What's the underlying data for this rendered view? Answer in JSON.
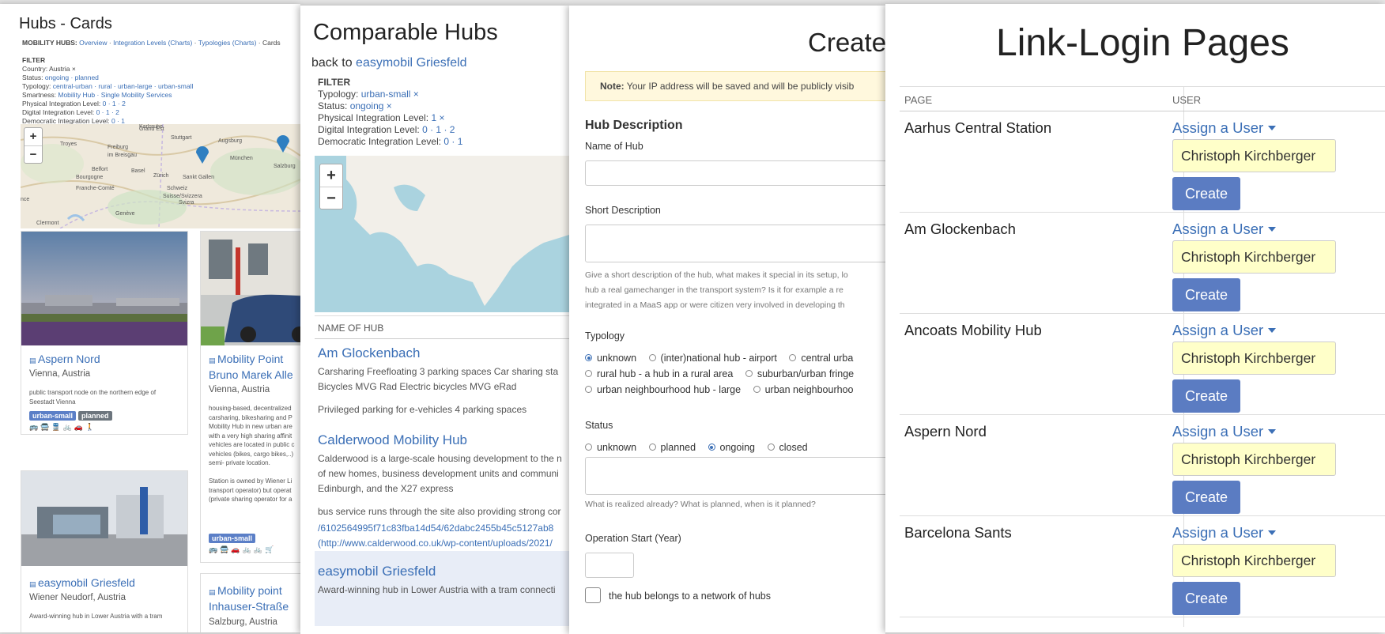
{
  "p1": {
    "title": "Hubs - Cards",
    "nav_prefix": "MOBILITY HUBS:",
    "nav_overview": "Overview",
    "nav_sep1": " · ",
    "nav_integration": "Integration Levels",
    "nav_charts1": "(Charts)",
    "nav_typologies": "Typologies",
    "nav_charts2": "(Charts)",
    "nav_cards": "· Cards",
    "filter_label": "FILTER",
    "f_country_label": "Country:",
    "f_country_value": "Austria ×",
    "f_status_label": "Status:",
    "f_status_value": "ongoing · planned",
    "f_typology_label": "Typology:",
    "f_typology_value": "central-urban · rural · urban-large · urban-small",
    "f_smart_label": "Smartness:",
    "f_smart_value": "Mobility Hub · Single Mobility Services",
    "f_phys_label": "Physical Integration Level:",
    "f_phys_value": "0 · 1 · 2",
    "f_digi_label": "Digital Integration Level:",
    "f_digi_value": "0 · 1 · 2",
    "f_demo_label": "Democratic Integration Level:",
    "f_demo_value": "0 · 1",
    "map_labels": [
      "Karlsruhe",
      "Stuttgart",
      "Augsburg",
      "Troyes",
      "Freiburg",
      "im Breisgau",
      "München",
      "Salzburg",
      "Belfort",
      "Basel",
      "Zürich",
      "Bourgogne",
      "Sankt Gallen",
      "Schweiz",
      "Suisse/Svizzera",
      "Genève",
      "Grand Est",
      "Franche-Comté",
      "nce",
      "Clermont",
      "Svizra"
    ],
    "cards": [
      {
        "title": "Aspern Nord",
        "sub": "Vienna, Austria",
        "desc1": "public transport node on the northern edge of",
        "desc2": "Seestadt Vienna",
        "badge1": "urban-small",
        "badge2": "planned",
        "icons": "🚌🚍🚆🚲🚗🚶"
      },
      {
        "title": "Mobility Point",
        "title2": "Bruno Marek Alle",
        "sub": "Vienna, Austria",
        "desc": [
          "housing-based, decentralized",
          "carsharing, bikesharing and P",
          "Mobility Hub in new urban are",
          "with a very high sharing affinit",
          "vehicles are located in public c",
          "vehicles (bikes, cargo bikes,..)",
          "semi- private location.",
          "",
          "Station is owned by Wiener Li",
          "transport operator) but operat",
          "(private sharing operator for a"
        ],
        "badge1": "urban-small",
        "icons": "🚌🚍🚗🚲🚲🛒"
      },
      {
        "title": "easymobil Griesfeld",
        "sub": "Wiener Neudorf, Austria",
        "desc1": "Award-winning hub in Lower Austria with a tram"
      },
      {
        "title": "Mobility point",
        "title2": "Inhauser-Straße",
        "sub": "Salzburg, Austria"
      }
    ]
  },
  "p2": {
    "title": "Comparable Hubs",
    "back_prefix": "back to",
    "back_link": "easymobil Griesfeld",
    "filter_label": "FILTER",
    "f_typology_label": "Typology:",
    "f_typology_value": "urban-small ×",
    "f_status_label": "Status:",
    "f_status_value": "ongoing ×",
    "f_phys_label": "Physical Integration Level:",
    "f_phys_value": "1 ×",
    "f_digi_label": "Digital Integration Level:",
    "f_digi_value": "0 · 1 · 2",
    "f_demo_label": "Democratic Integration Level:",
    "f_demo_value": "0 · 1",
    "col_header": "NAME OF HUB",
    "hubs": [
      {
        "name": "Am Glockenbach",
        "lines": [
          "Carsharing Freefloating 3 parking spaces Car sharing sta",
          "Bicycles MVG Rad Electric bicycles MVG eRad",
          "",
          "Privileged parking for e-vehicles 4 parking spaces"
        ]
      },
      {
        "name": "Calderwood Mobility Hub",
        "lines": [
          "Calderwood is a large-scale housing development to the n",
          "of new homes, business development units and communi",
          "Edinburgh, and the X27 express",
          "",
          "bus service runs through the site also providing strong cor"
        ],
        "links": [
          "/6102564995f71c83fba14d54/62dabc2455b45c5127ab8",
          "(http://www.calderwood.co.uk/wp-content/uploads/2021/"
        ]
      },
      {
        "name": "easymobil Griesfeld",
        "lines": [
          "Award-winning hub in Lower Austria with a tram connecti"
        ]
      }
    ]
  },
  "p3": {
    "title": "Create",
    "note_bold": "Note:",
    "note_text": "Your IP address will be saved and will be publicly visib",
    "section": "Hub Description",
    "name_label": "Name of Hub",
    "short_label": "Short Description",
    "short_help": [
      "Give a short description of the hub, what makes it special in its setup, lo",
      "hub a real gamechanger in the transport system? Is it for example a re",
      "integrated in a MaaS app or were citizen very involved in developing th"
    ],
    "typology_label": "Typology",
    "typology_row1": [
      "unknown",
      "(inter)national hub - airport",
      "central urba"
    ],
    "typology_row2": [
      "rural hub - a hub in a rural area",
      "suburban/urban fringe"
    ],
    "typology_row3": [
      "urban neighbourhood hub - large",
      "urban neighbourhoo"
    ],
    "status_label": "Status",
    "status_options": [
      "unknown",
      "planned",
      "ongoing",
      "closed"
    ],
    "status_help": "What is realized already? What is planned, when is it planned?",
    "op_label": "Operation Start (Year)",
    "network_label": "the hub belongs to a network of hubs"
  },
  "p4": {
    "title": "Link-Login Pages",
    "col_page": "PAGE",
    "col_user": "USER",
    "assign_label": "Assign a User",
    "user_value": "Christoph Kirchberger",
    "create_label": "Create",
    "rows": [
      "Aarhus Central Station",
      "Am Glockenbach",
      "Ancoats Mobility Hub",
      "Aspern Nord",
      "Barcelona Sants"
    ]
  }
}
